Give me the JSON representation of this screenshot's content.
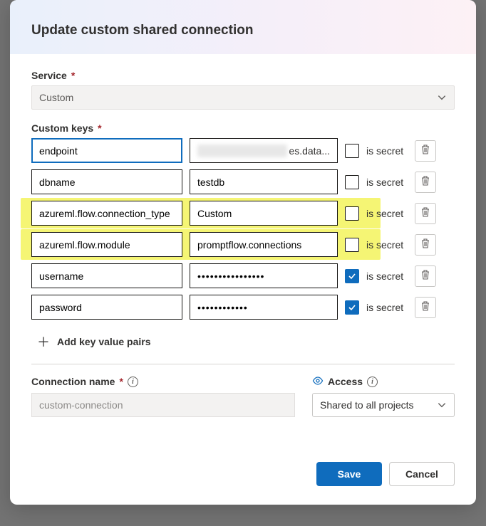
{
  "dialog": {
    "title": "Update custom shared connection",
    "service": {
      "label": "Service",
      "value": "Custom"
    },
    "customKeys": {
      "label": "Custom keys",
      "isSecretLabel": "is secret",
      "addLabel": "Add key value pairs",
      "rows": [
        {
          "key": "endpoint",
          "value": "es.data...",
          "valueBlurredPrefix": true,
          "secret": false,
          "highlight": false,
          "focused": true
        },
        {
          "key": "dbname",
          "value": "testdb",
          "secret": false,
          "highlight": false
        },
        {
          "key": "azureml.flow.connection_type",
          "value": "Custom",
          "secret": false,
          "highlight": true
        },
        {
          "key": "azureml.flow.module",
          "value": "promptflow.connections",
          "secret": false,
          "highlight": true
        },
        {
          "key": "username",
          "value": "••••••••••••••••",
          "secret": true,
          "highlight": false
        },
        {
          "key": "password",
          "value": "••••••••••••",
          "secret": true,
          "highlight": false
        }
      ]
    },
    "connectionName": {
      "label": "Connection name",
      "value": "custom-connection"
    },
    "access": {
      "label": "Access",
      "value": "Shared to all projects"
    },
    "buttons": {
      "save": "Save",
      "cancel": "Cancel"
    }
  }
}
